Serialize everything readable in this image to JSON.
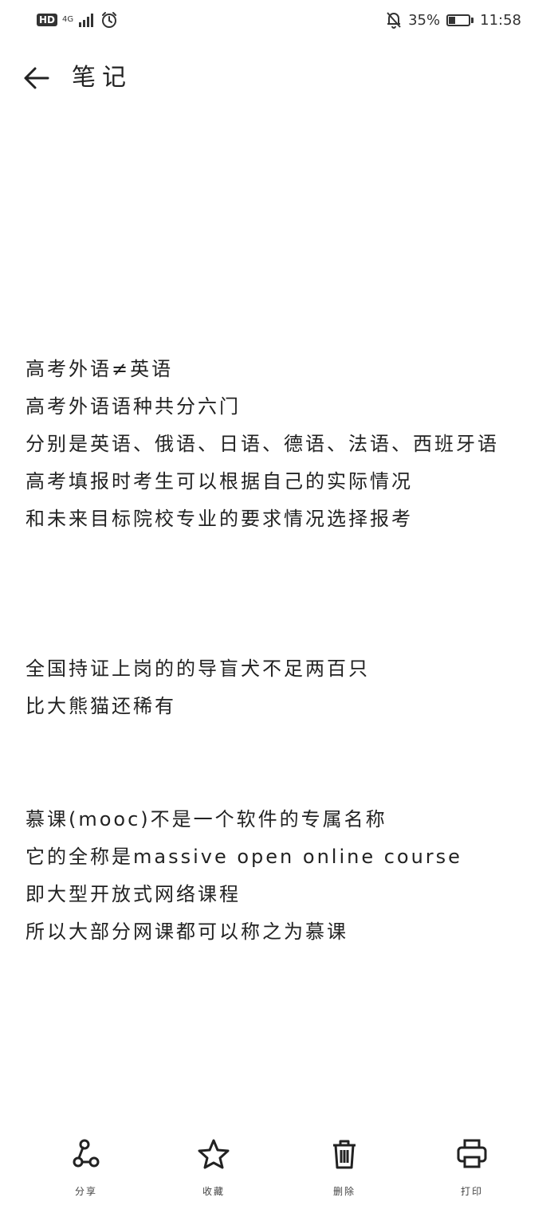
{
  "status_bar": {
    "hd": "HD",
    "network": "4G",
    "battery_percent": "35%",
    "battery_level": 0.35,
    "time": "11:58"
  },
  "header": {
    "title": "笔记"
  },
  "note": {
    "paragraphs": [
      {
        "lines": [
          "高考外语≠英语",
          "高考外语语种共分六门",
          "分别是英语、俄语、日语、德语、法语、西班牙语",
          "高考填报时考生可以根据自己的实际情况",
          "和未来目标院校专业的要求情况选择报考"
        ]
      },
      {
        "lines": [
          "全国持证上岗的的导盲犬不足两百只",
          "比大熊猫还稀有"
        ]
      },
      {
        "lines": [
          "慕课(mooc)不是一个软件的专属名称",
          "它的全称是massive open online course",
          "即大型开放式网络课程",
          "所以大部分网课都可以称之为慕课"
        ]
      }
    ]
  },
  "bottom_bar": {
    "share_label": "分享",
    "favorite_label": "收藏",
    "delete_label": "删除",
    "print_label": "打印"
  }
}
